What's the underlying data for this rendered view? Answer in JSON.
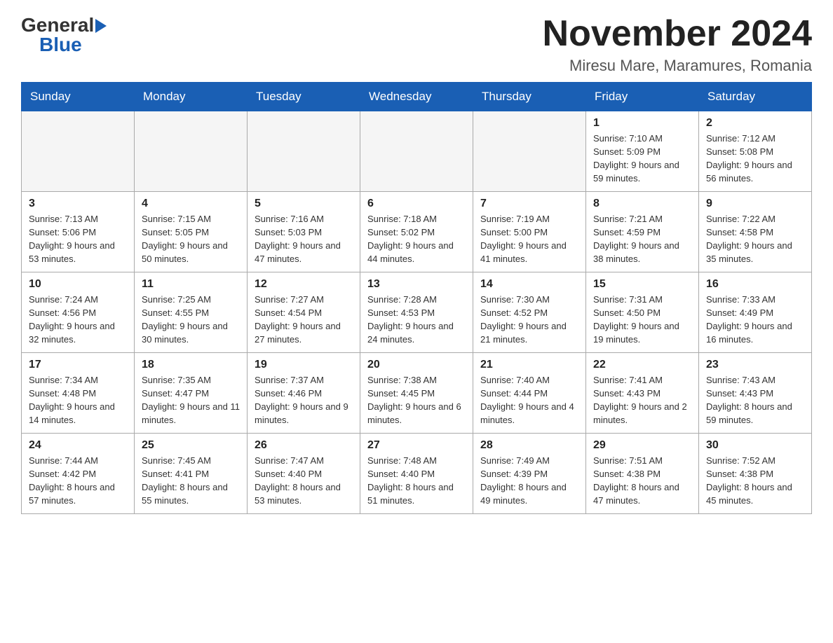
{
  "header": {
    "logo_general": "General",
    "logo_blue": "Blue",
    "month_title": "November 2024",
    "location": "Miresu Mare, Maramures, Romania"
  },
  "weekdays": [
    "Sunday",
    "Monday",
    "Tuesday",
    "Wednesday",
    "Thursday",
    "Friday",
    "Saturday"
  ],
  "weeks": [
    [
      {
        "day": "",
        "sunrise": "",
        "sunset": "",
        "daylight": ""
      },
      {
        "day": "",
        "sunrise": "",
        "sunset": "",
        "daylight": ""
      },
      {
        "day": "",
        "sunrise": "",
        "sunset": "",
        "daylight": ""
      },
      {
        "day": "",
        "sunrise": "",
        "sunset": "",
        "daylight": ""
      },
      {
        "day": "",
        "sunrise": "",
        "sunset": "",
        "daylight": ""
      },
      {
        "day": "1",
        "sunrise": "Sunrise: 7:10 AM",
        "sunset": "Sunset: 5:09 PM",
        "daylight": "Daylight: 9 hours and 59 minutes."
      },
      {
        "day": "2",
        "sunrise": "Sunrise: 7:12 AM",
        "sunset": "Sunset: 5:08 PM",
        "daylight": "Daylight: 9 hours and 56 minutes."
      }
    ],
    [
      {
        "day": "3",
        "sunrise": "Sunrise: 7:13 AM",
        "sunset": "Sunset: 5:06 PM",
        "daylight": "Daylight: 9 hours and 53 minutes."
      },
      {
        "day": "4",
        "sunrise": "Sunrise: 7:15 AM",
        "sunset": "Sunset: 5:05 PM",
        "daylight": "Daylight: 9 hours and 50 minutes."
      },
      {
        "day": "5",
        "sunrise": "Sunrise: 7:16 AM",
        "sunset": "Sunset: 5:03 PM",
        "daylight": "Daylight: 9 hours and 47 minutes."
      },
      {
        "day": "6",
        "sunrise": "Sunrise: 7:18 AM",
        "sunset": "Sunset: 5:02 PM",
        "daylight": "Daylight: 9 hours and 44 minutes."
      },
      {
        "day": "7",
        "sunrise": "Sunrise: 7:19 AM",
        "sunset": "Sunset: 5:00 PM",
        "daylight": "Daylight: 9 hours and 41 minutes."
      },
      {
        "day": "8",
        "sunrise": "Sunrise: 7:21 AM",
        "sunset": "Sunset: 4:59 PM",
        "daylight": "Daylight: 9 hours and 38 minutes."
      },
      {
        "day": "9",
        "sunrise": "Sunrise: 7:22 AM",
        "sunset": "Sunset: 4:58 PM",
        "daylight": "Daylight: 9 hours and 35 minutes."
      }
    ],
    [
      {
        "day": "10",
        "sunrise": "Sunrise: 7:24 AM",
        "sunset": "Sunset: 4:56 PM",
        "daylight": "Daylight: 9 hours and 32 minutes."
      },
      {
        "day": "11",
        "sunrise": "Sunrise: 7:25 AM",
        "sunset": "Sunset: 4:55 PM",
        "daylight": "Daylight: 9 hours and 30 minutes."
      },
      {
        "day": "12",
        "sunrise": "Sunrise: 7:27 AM",
        "sunset": "Sunset: 4:54 PM",
        "daylight": "Daylight: 9 hours and 27 minutes."
      },
      {
        "day": "13",
        "sunrise": "Sunrise: 7:28 AM",
        "sunset": "Sunset: 4:53 PM",
        "daylight": "Daylight: 9 hours and 24 minutes."
      },
      {
        "day": "14",
        "sunrise": "Sunrise: 7:30 AM",
        "sunset": "Sunset: 4:52 PM",
        "daylight": "Daylight: 9 hours and 21 minutes."
      },
      {
        "day": "15",
        "sunrise": "Sunrise: 7:31 AM",
        "sunset": "Sunset: 4:50 PM",
        "daylight": "Daylight: 9 hours and 19 minutes."
      },
      {
        "day": "16",
        "sunrise": "Sunrise: 7:33 AM",
        "sunset": "Sunset: 4:49 PM",
        "daylight": "Daylight: 9 hours and 16 minutes."
      }
    ],
    [
      {
        "day": "17",
        "sunrise": "Sunrise: 7:34 AM",
        "sunset": "Sunset: 4:48 PM",
        "daylight": "Daylight: 9 hours and 14 minutes."
      },
      {
        "day": "18",
        "sunrise": "Sunrise: 7:35 AM",
        "sunset": "Sunset: 4:47 PM",
        "daylight": "Daylight: 9 hours and 11 minutes."
      },
      {
        "day": "19",
        "sunrise": "Sunrise: 7:37 AM",
        "sunset": "Sunset: 4:46 PM",
        "daylight": "Daylight: 9 hours and 9 minutes."
      },
      {
        "day": "20",
        "sunrise": "Sunrise: 7:38 AM",
        "sunset": "Sunset: 4:45 PM",
        "daylight": "Daylight: 9 hours and 6 minutes."
      },
      {
        "day": "21",
        "sunrise": "Sunrise: 7:40 AM",
        "sunset": "Sunset: 4:44 PM",
        "daylight": "Daylight: 9 hours and 4 minutes."
      },
      {
        "day": "22",
        "sunrise": "Sunrise: 7:41 AM",
        "sunset": "Sunset: 4:43 PM",
        "daylight": "Daylight: 9 hours and 2 minutes."
      },
      {
        "day": "23",
        "sunrise": "Sunrise: 7:43 AM",
        "sunset": "Sunset: 4:43 PM",
        "daylight": "Daylight: 8 hours and 59 minutes."
      }
    ],
    [
      {
        "day": "24",
        "sunrise": "Sunrise: 7:44 AM",
        "sunset": "Sunset: 4:42 PM",
        "daylight": "Daylight: 8 hours and 57 minutes."
      },
      {
        "day": "25",
        "sunrise": "Sunrise: 7:45 AM",
        "sunset": "Sunset: 4:41 PM",
        "daylight": "Daylight: 8 hours and 55 minutes."
      },
      {
        "day": "26",
        "sunrise": "Sunrise: 7:47 AM",
        "sunset": "Sunset: 4:40 PM",
        "daylight": "Daylight: 8 hours and 53 minutes."
      },
      {
        "day": "27",
        "sunrise": "Sunrise: 7:48 AM",
        "sunset": "Sunset: 4:40 PM",
        "daylight": "Daylight: 8 hours and 51 minutes."
      },
      {
        "day": "28",
        "sunrise": "Sunrise: 7:49 AM",
        "sunset": "Sunset: 4:39 PM",
        "daylight": "Daylight: 8 hours and 49 minutes."
      },
      {
        "day": "29",
        "sunrise": "Sunrise: 7:51 AM",
        "sunset": "Sunset: 4:38 PM",
        "daylight": "Daylight: 8 hours and 47 minutes."
      },
      {
        "day": "30",
        "sunrise": "Sunrise: 7:52 AM",
        "sunset": "Sunset: 4:38 PM",
        "daylight": "Daylight: 8 hours and 45 minutes."
      }
    ]
  ]
}
